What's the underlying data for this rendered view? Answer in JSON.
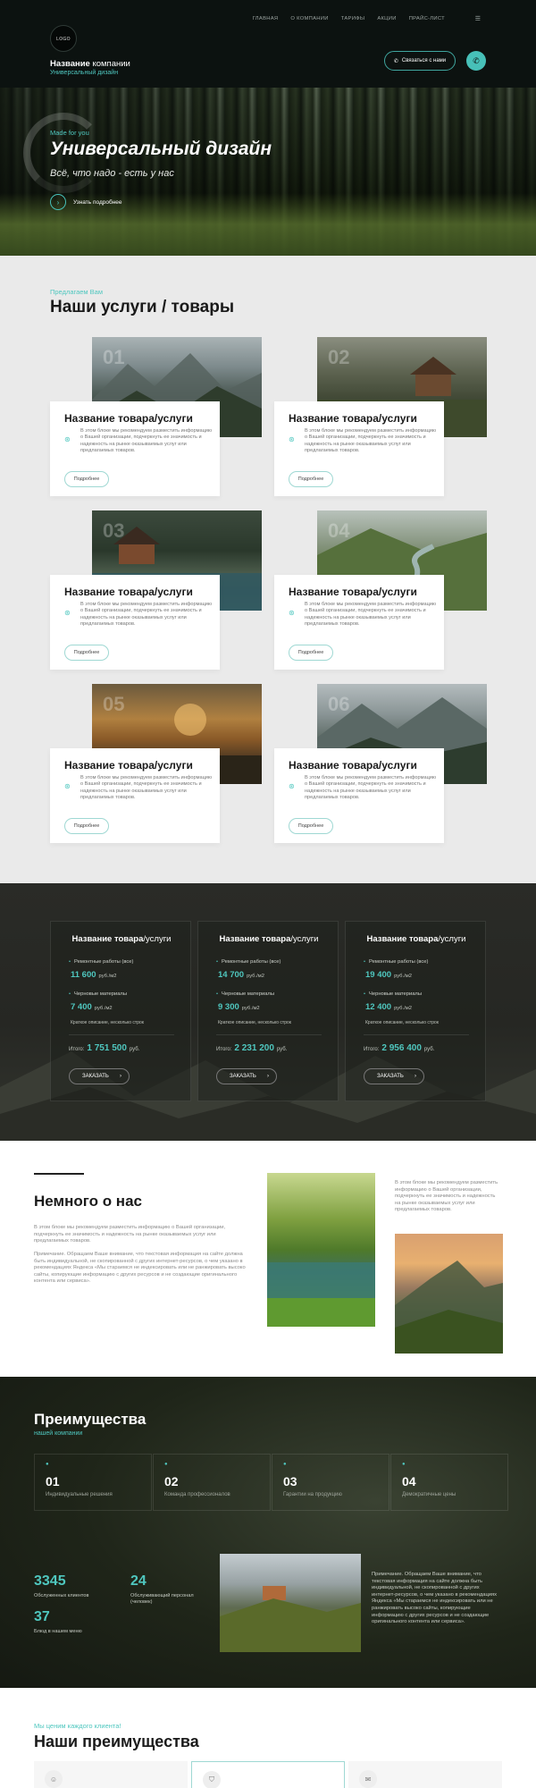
{
  "header": {
    "logo_text": "LOGO",
    "company_name_bold": "Название",
    "company_name_rest": " компании",
    "company_subtitle": "Универсальный дизайн",
    "nav": [
      "ГЛАВНАЯ",
      "О КОМПАНИИ",
      "ТАРИФЫ",
      "АКЦИИ",
      "ПРАЙС-ЛИСТ"
    ],
    "nav_icon": "☰",
    "contact_label": "Связаться с нами"
  },
  "hero": {
    "made_for": "Made for you",
    "title": "Универсальный дизайн",
    "subtitle": "Всё, что надо - есть у нас",
    "more_label": "Узнать подробнее"
  },
  "services": {
    "eyebrow": "Предлагаем Вам",
    "title": "Наши услуги / товары",
    "items": [
      {
        "num": "01",
        "title": "Название товара/услуги",
        "text": "В этом блоке мы рекомендуем разместить информацию о Вашей организации, подчеркнуть ее значимость и надежность на рынке оказываемых услуг или предлагаемых товаров.",
        "button": "Подробнее"
      },
      {
        "num": "02",
        "title": "Название товара/услуги",
        "text": "В этом блоке мы рекомендуем разместить информацию о Вашей организации, подчеркнуть ее значимость и надежность на рынке оказываемых услуг или предлагаемых товаров.",
        "button": "Подробнее"
      },
      {
        "num": "03",
        "title": "Название товара/услуги",
        "text": "В этом блоке мы рекомендуем разместить информацию о Вашей организации, подчеркнуть ее значимость и надежность на рынке оказываемых услуг или предлагаемых товаров.",
        "button": "Подробнее"
      },
      {
        "num": "04",
        "title": "Название товара/услуги",
        "text": "В этом блоке мы рекомендуем разместить информацию о Вашей организации, подчеркнуть ее значимость и надежность на рынке оказываемых услуг или предлагаемых товаров.",
        "button": "Подробнее"
      },
      {
        "num": "05",
        "title": "Название товара/услуги",
        "text": "В этом блоке мы рекомендуем разместить информацию о Вашей организации, подчеркнуть ее значимость и надежность на рынке оказываемых услуг или предлагаемых товаров.",
        "button": "Подробнее"
      },
      {
        "num": "06",
        "title": "Название товара/услуги",
        "text": "В этом блоке мы рекомендуем разместить информацию о Вашей организации, подчеркнуть ее значимость и надежность на рынке оказываемых услуг или предлагаемых товаров.",
        "button": "Подробнее"
      }
    ]
  },
  "pricing": {
    "cards": [
      {
        "title_bold": "Название товара",
        "title_rest": "/услуги",
        "work_label": "Ремонтные работы (все)",
        "work_value": "11 600",
        "work_unit": "руб./м2",
        "mat_label": "Черновые материалы",
        "mat_value": "7 400",
        "mat_unit": "руб./м2",
        "note": "Краткое описание, несколько строк",
        "total_label": "Итого:",
        "total_value": "1 751 500",
        "total_unit": "руб.",
        "button": "ЗАКАЗАТЬ"
      },
      {
        "title_bold": "Название товара",
        "title_rest": "/услуги",
        "work_label": "Ремонтные работы (все)",
        "work_value": "14 700",
        "work_unit": "руб./м2",
        "mat_label": "Черновые материалы",
        "mat_value": "9 300",
        "mat_unit": "руб./м2",
        "note": "Краткое описание, несколько строк",
        "total_label": "Итого:",
        "total_value": "2 231 200",
        "total_unit": "руб.",
        "button": "ЗАКАЗАТЬ"
      },
      {
        "title_bold": "Название товара",
        "title_rest": "/услуги",
        "work_label": "Ремонтные работы (все)",
        "work_value": "19 400",
        "work_unit": "руб./м2",
        "mat_label": "Черновые материалы",
        "mat_value": "12 400",
        "mat_unit": "руб./м2",
        "note": "Краткое описание, несколько строк",
        "total_label": "Итого:",
        "total_value": "2 956 400",
        "total_unit": "руб.",
        "button": "ЗАКАЗАТЬ"
      }
    ]
  },
  "about": {
    "title": "Немного о нас",
    "p1": "В этом блоке мы рекомендуем разместить информацию о Вашей организации, подчеркнуть ее значимость и надежность на рынке оказываемых услуг или предлагаемых товаров.",
    "p2": "Примечание. Обращаем Ваше внимание, что текстовая информация на сайте должна быть индивидуальной, не скопированной с других интернет-ресурсов, о чем указано в рекомендациях Яндекса «Мы стараемся не индексировать или не ранжировать высоко сайты, копирующие информацию с других ресурсов и не создающие оригинального контента или сервиса».",
    "side": "В этом блоке мы рекомендуем разместить информацию о Вашей организации, подчеркнуть ее значимость и надежность на рынке оказываемых услуг или предлагаемых товаров."
  },
  "advantages": {
    "title": "Преимущества",
    "subtitle": "нашей компании",
    "boxes": [
      {
        "num": "01",
        "label": "Индивидуальные решения"
      },
      {
        "num": "02",
        "label": "Команда профессионалов"
      },
      {
        "num": "03",
        "label": "Гарантии на продукцию"
      },
      {
        "num": "04",
        "label": "Демократичные цены"
      }
    ],
    "stats": [
      {
        "value": "3345",
        "label": "Обслуженных клиентов"
      },
      {
        "value": "24",
        "label": "Обслуживающий персонал (человек)"
      },
      {
        "value": "37",
        "label": "Блюд в нашем меню"
      }
    ],
    "note": "Примечание. Обращаем Ваше внимание, что текстовая информация на сайте должна быть индивидуальной, не скопированной с других интернет-ресурсов, о чем указано в рекомендациях Яндекса «Мы стараемся не индексировать или не ранжировать высоко сайты, копирующие информацию с других ресурсов и не создающие оригинального контента или сервиса»."
  },
  "our_advantages": {
    "eyebrow": "Мы ценим каждого клиента!",
    "title": "Наши преимущества",
    "icons": [
      "☺",
      "⛉",
      "✉"
    ]
  }
}
